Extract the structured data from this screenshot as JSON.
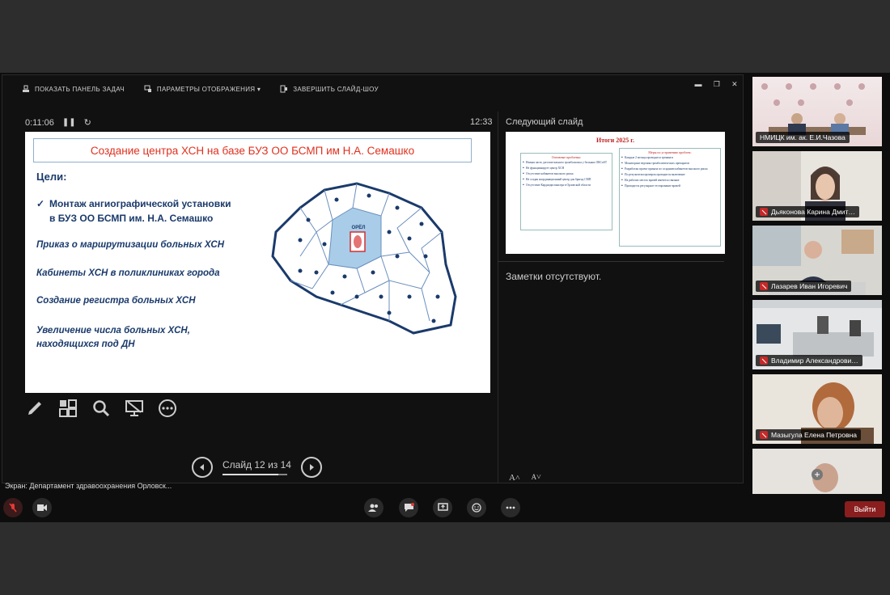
{
  "toolbar": {
    "show_taskbar": "ПОКАЗАТЬ ПАНЕЛЬ ЗАДАЧ",
    "display_settings": "ПАРАМЕТРЫ ОТОБРАЖЕНИЯ ▾",
    "end_slideshow": "ЗАВЕРШИТЬ СЛАЙД-ШОУ"
  },
  "presenter": {
    "elapsed": "0:11:06",
    "clock": "12:33",
    "next_slide_label": "Следующий слайд",
    "notes": "Заметки отсутствуют.",
    "slide_counter": "Слайд 12 из 14",
    "progress": 0.857
  },
  "slide": {
    "title": "Создание центра ХСН на базе БУЗ ОО БСМП им Н.А. Семашко",
    "goals_heading": "Цели:",
    "goal1_line1": "Монтаж ангиографической установки",
    "goal1_line2": "в БУЗ ОО БСМП  им. Н.А. Семашко",
    "goal2": "Приказ о маршрутизации больных ХСН",
    "goal3": "Кабинеты ХСН в поликлиниках города",
    "goal4": "Создание регистра больных ХСН",
    "goal5_line1": "Увеличение числа больных ХСН,",
    "goal5_line2": "находящихся под ДН",
    "map_city": "ОРЁЛ"
  },
  "preview": {
    "title": "Итоги 2025 г.",
    "left_heading": "Основные проблемы:",
    "left_items": [
      "Низкая часть догоспитального тромболизиса у больных ОКСпST",
      "Не функционирует центр ХСН",
      "Отсутствие кабинетов высокого риска",
      "Не создан координационный центр для бригад СМП",
      "Отсутствие Кардиодиспансера в Орловской области"
    ],
    "right_heading": "Меры по устранению проблем:",
    "right_items": [
      "Каждые 2 месяца проводятся тренинги",
      "Мониторинг ведения тромболитических препаратов",
      "Разработан проект приказа по созданию кабинетов высокого риска",
      "По результатам проверок проводится включение",
      "На рабочих местах врачей имеются связные",
      "Проводится регулярное тестирование врачей"
    ]
  },
  "screen_share_label": "Экран: Департамент здравоохранения Орловск...",
  "participants": [
    {
      "name": "НМИЦК им. ак. Е.И.Чазова",
      "muted": false
    },
    {
      "name": "Дьяконова Карина Дмит…",
      "muted": true
    },
    {
      "name": "Лазарев Иван Игоревич",
      "muted": true
    },
    {
      "name": "Владимир Александрови…",
      "muted": true
    },
    {
      "name": "Мазыгула Елена Петровна",
      "muted": true
    }
  ],
  "bottombar": {
    "leave": "Выйти"
  },
  "font_controls": {
    "increase": "A",
    "decrease": "A"
  }
}
